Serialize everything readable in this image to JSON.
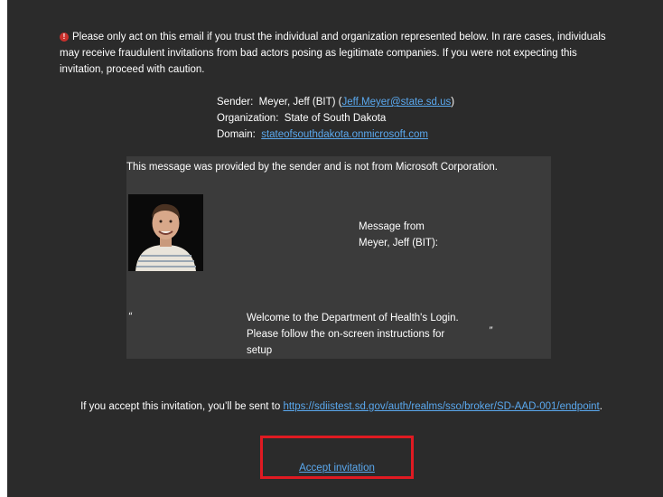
{
  "warning": {
    "icon": "error-icon",
    "text": "Please only act on this email if you trust the individual and organization represented below. In rare cases, individuals may receive fraudulent invitations from bad actors posing as legitimate companies. If you were not expecting this invitation, proceed with caution."
  },
  "sender": {
    "sender_label": "Sender:",
    "sender_name": "Meyer, Jeff (BIT)",
    "sender_open": "(",
    "sender_email": "Jeff.Meyer@state.sd.us",
    "sender_close": ")",
    "org_label": "Organization:",
    "org_value": "State of South Dakota",
    "domain_label": "Domain:",
    "domain_value": "stateofsouthdakota.onmicrosoft.com"
  },
  "message": {
    "provided_notice": "This message was provided by the sender and is not from Microsoft Corporation.",
    "from_line1": "Message from",
    "from_line2": "Meyer, Jeff (BIT):",
    "open_quote": "“",
    "close_quote": "”",
    "body": "Welcome to the Department of Health's Login. Please follow the on-screen instructions for setup"
  },
  "accept": {
    "info_prefix": "If you accept this invitation, you’ll be sent to",
    "url": "https://sdiistest.sd.gov/auth/realms/sso/broker/SD-AAD-001/endpoint",
    "info_suffix": ".",
    "button_label": "Accept invitation"
  },
  "colors": {
    "background": "#2b2b2b",
    "message_box": "#3b3b3b",
    "link": "#5aa8ee",
    "highlight_border": "#e01a22",
    "warning_icon": "#c9302c"
  }
}
